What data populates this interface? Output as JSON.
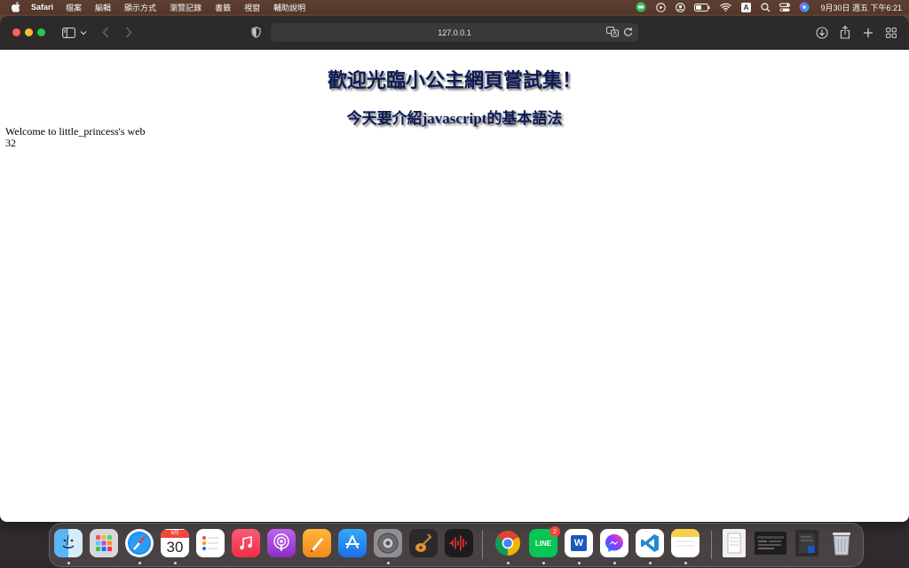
{
  "menubar": {
    "app_name": "Safari",
    "items": [
      "檔案",
      "編輯",
      "顯示方式",
      "瀏覽記錄",
      "書籤",
      "視窗",
      "輔助說明"
    ],
    "clock": "9月30日 週五 下午6:21",
    "input_label": "A"
  },
  "browser": {
    "url": "127.0.0.1"
  },
  "page": {
    "heading": "歡迎光臨小公主網頁嘗試集！",
    "subheading": "今天要介紹javascript的基本語法",
    "welcome_text": "Welcome to little_princess's web",
    "number_output": "32"
  },
  "dock": {
    "calendar_month": "9月",
    "calendar_day": "30",
    "line_badge": "2",
    "line_label": "LINE",
    "word_label": "W"
  },
  "colors": {
    "heading": "#0d1a52",
    "toolbar": "#2d2a2c",
    "menubar": "#5c3d30"
  }
}
